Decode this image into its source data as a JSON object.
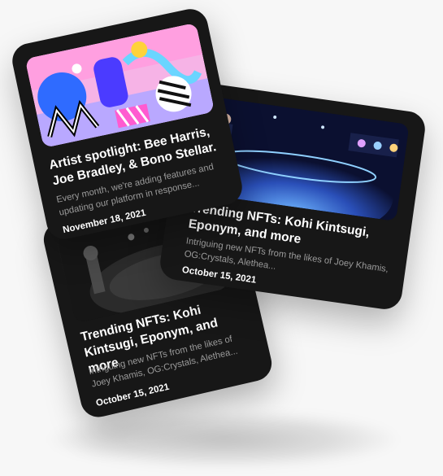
{
  "cards": [
    {
      "title": "Artist spotlight: Bee Harris, Joe Bradley, & Bono Stellar.",
      "description": "Every month, we're adding features and updating our platform in response...",
      "date": "November 18, 2021"
    },
    {
      "title": "Trending NFTs: Kohi Kintsugi, Eponym, and more",
      "description": "Intriguing new NFTs from the likes of Joey Khamis, OG:Crystals, Alethea...",
      "date": "October 15, 2021"
    },
    {
      "title": "Trending NFTs: Kohi Kintsugi, Eponym, and more",
      "description": "Intriguing new NFTs from the likes of Joey Khamis, OG:Crystals, Alethea...",
      "date": "October 15, 2021"
    }
  ]
}
